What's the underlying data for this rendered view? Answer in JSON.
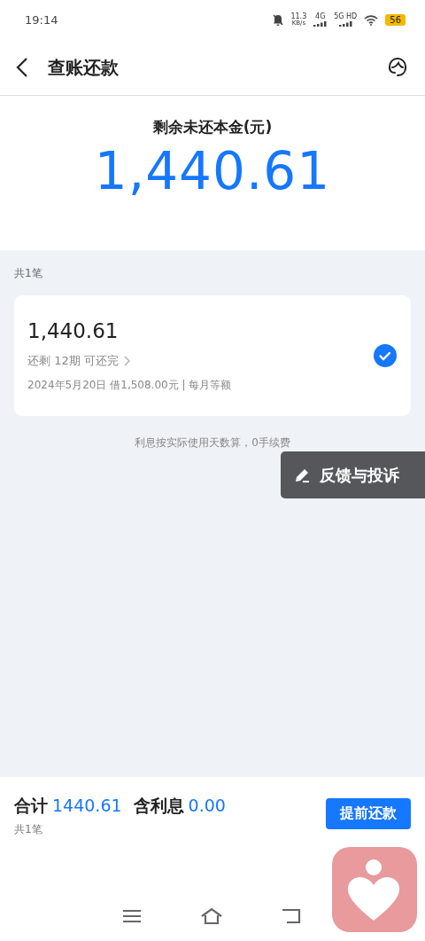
{
  "status_bar": {
    "time": "19:14",
    "speed": "11.3",
    "speed_unit": "KB/s",
    "network_1": "4G",
    "network_2": "5G HD",
    "battery": "56"
  },
  "header": {
    "title": "查账还款"
  },
  "summary": {
    "label": "剩余未还本金(元)",
    "amount": "1,440.61"
  },
  "list": {
    "count": "共1笔",
    "loans": [
      {
        "amount": "1,440.61",
        "remaining": "还剩 12期 可还完",
        "detail": "2024年5月20日 借1,508.00元 | 每月等额",
        "selected": true
      }
    ]
  },
  "note": "利息按实际使用天数算，0手续费",
  "feedback": {
    "label": "反馈与投诉"
  },
  "footer": {
    "total_label": "合计",
    "total": "1440.61",
    "interest_label": "含利息",
    "interest": "0.00",
    "count": "共1笔",
    "button": "提前还款"
  }
}
